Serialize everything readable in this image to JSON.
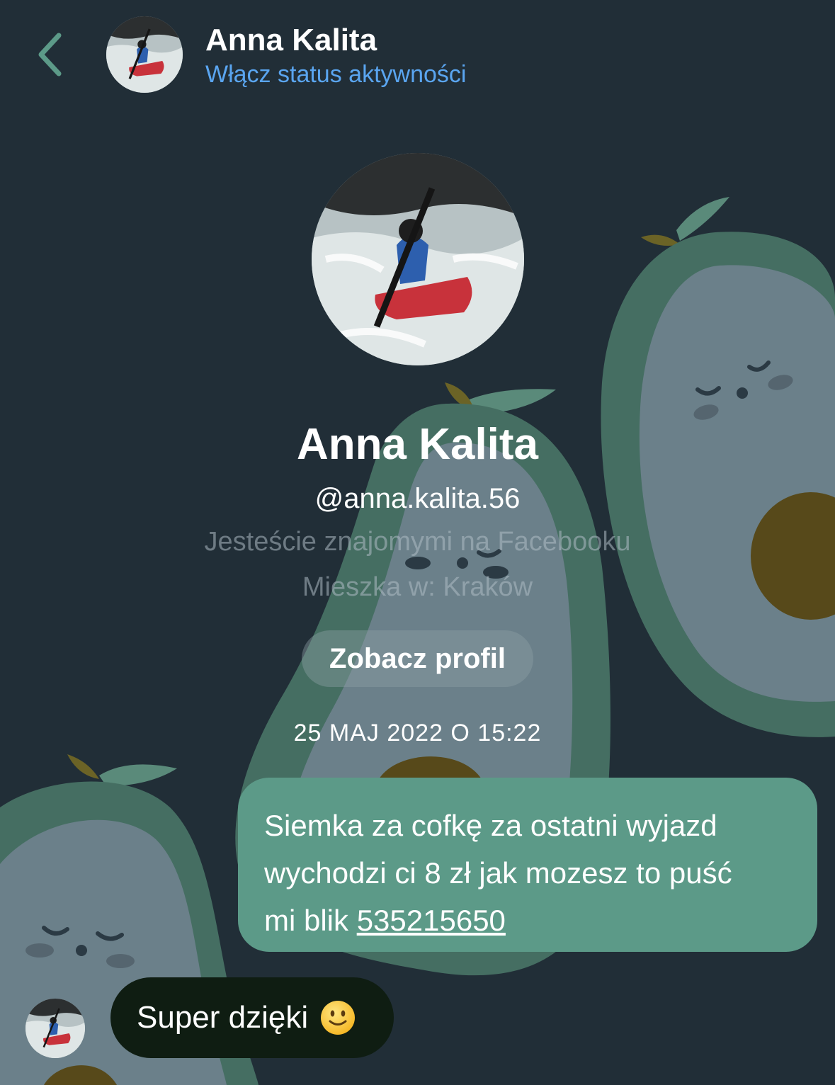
{
  "header": {
    "back_label": "Wstecz",
    "contact_name": "Anna Kalita",
    "activity_status": "Włącz status aktywności"
  },
  "profile": {
    "name": "Anna Kalita",
    "handle": "@anna.kalita.56",
    "friends_note": "Jesteście znajomymi na Facebooku",
    "location": "Mieszka w: Kraków",
    "view_profile_label": "Zobacz profil"
  },
  "conversation": {
    "timestamp": "25 MAJ 2022 O 15:22",
    "messages": [
      {
        "direction": "outgoing",
        "lines": [
          "Siemka za cofkę za ostatni wyjazd",
          "wychodzi ci 8 zł jak mozesz to puść",
          "mi blik "
        ],
        "link_number": "535215650"
      },
      {
        "direction": "incoming",
        "text": "Super dzięki",
        "emoji": "slightly-smiling-face-icon"
      }
    ]
  },
  "colors": {
    "background": "#212e37",
    "outgoing_bubble": "#5c9a88",
    "incoming_bubble": "#0f1d12",
    "status_link": "#5aa5f0",
    "back_arrow": "#5c9a88"
  }
}
